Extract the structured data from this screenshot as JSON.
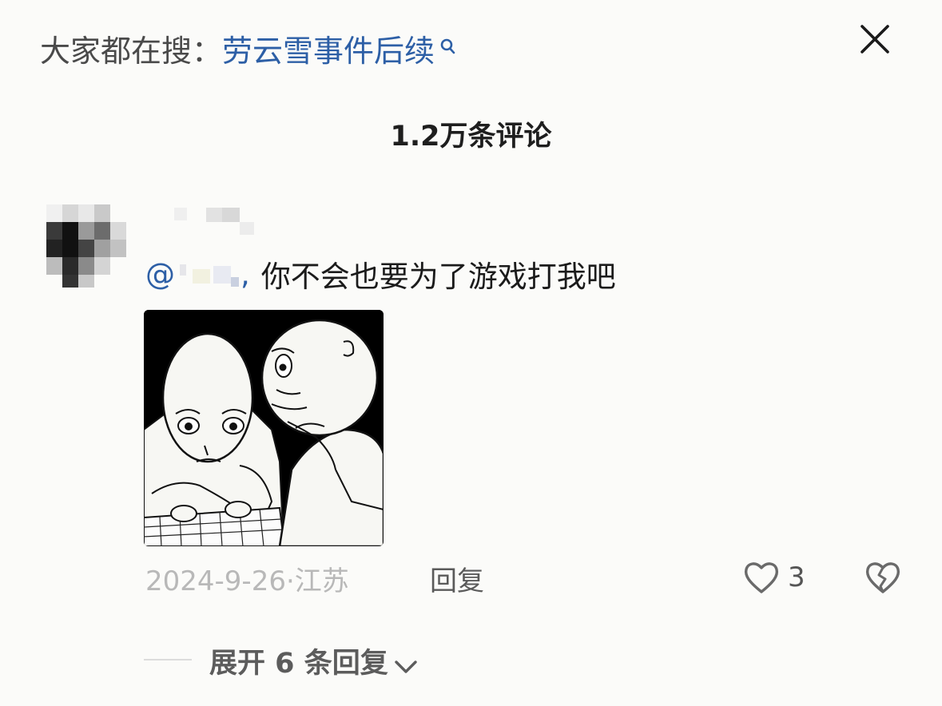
{
  "header": {
    "search_prefix": "大家都在搜",
    "search_sep": "：",
    "search_term": "劳云雪事件后续",
    "search_icon": "search-icon",
    "close_icon": "close-icon"
  },
  "comments_panel": {
    "count_label": "1.2万条评论"
  },
  "comment": {
    "avatar": "avatar-pixelated",
    "mention_at": "@",
    "mention_comma": ",",
    "text": "你不会也要为了游戏打我吧",
    "image": "comment-image-sketch",
    "date": "2024-9-26",
    "location_sep": "·",
    "location": "江苏",
    "reply_label": "回复",
    "like_count": "3",
    "like_icon": "heart-icon",
    "dislike_icon": "broken-heart-icon"
  },
  "replies": {
    "expand_label": "展开 6 条回复",
    "expand_icon": "chevron-down-icon"
  },
  "colors": {
    "background": "#fbfbf9",
    "link_blue": "#2d5fa6",
    "meta_gray": "#b8b8b8"
  }
}
